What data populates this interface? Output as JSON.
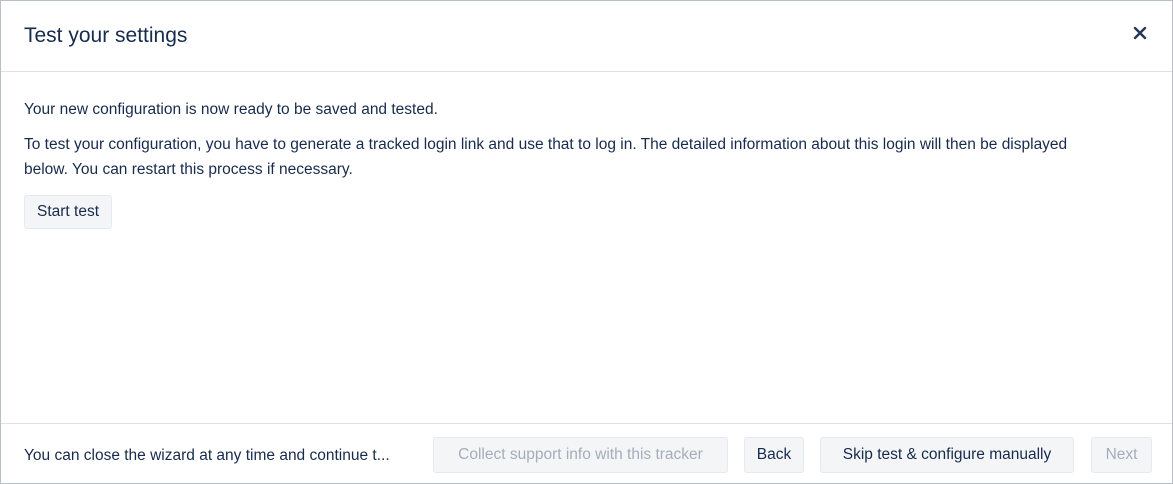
{
  "dialog": {
    "title": "Test your settings",
    "close_icon": "close-icon"
  },
  "body": {
    "intro": "Your new configuration is now ready to be saved and tested.",
    "instructions": "To test your configuration, you have to generate a tracked login link and use that to log in. The detailed information about this login will then be displayed below. You can restart this process if necessary.",
    "start_test_label": "Start test"
  },
  "footer": {
    "note": "You can close the wizard at any time and continue t...",
    "collect_label": "Collect support info with this tracker",
    "back_label": "Back",
    "skip_label": "Skip test & configure manually",
    "next_label": "Next"
  },
  "colors": {
    "text": "#172b4d",
    "disabled_text": "#a5adba",
    "button_bg": "#f4f5f7",
    "divider": "#dfe1e6"
  }
}
